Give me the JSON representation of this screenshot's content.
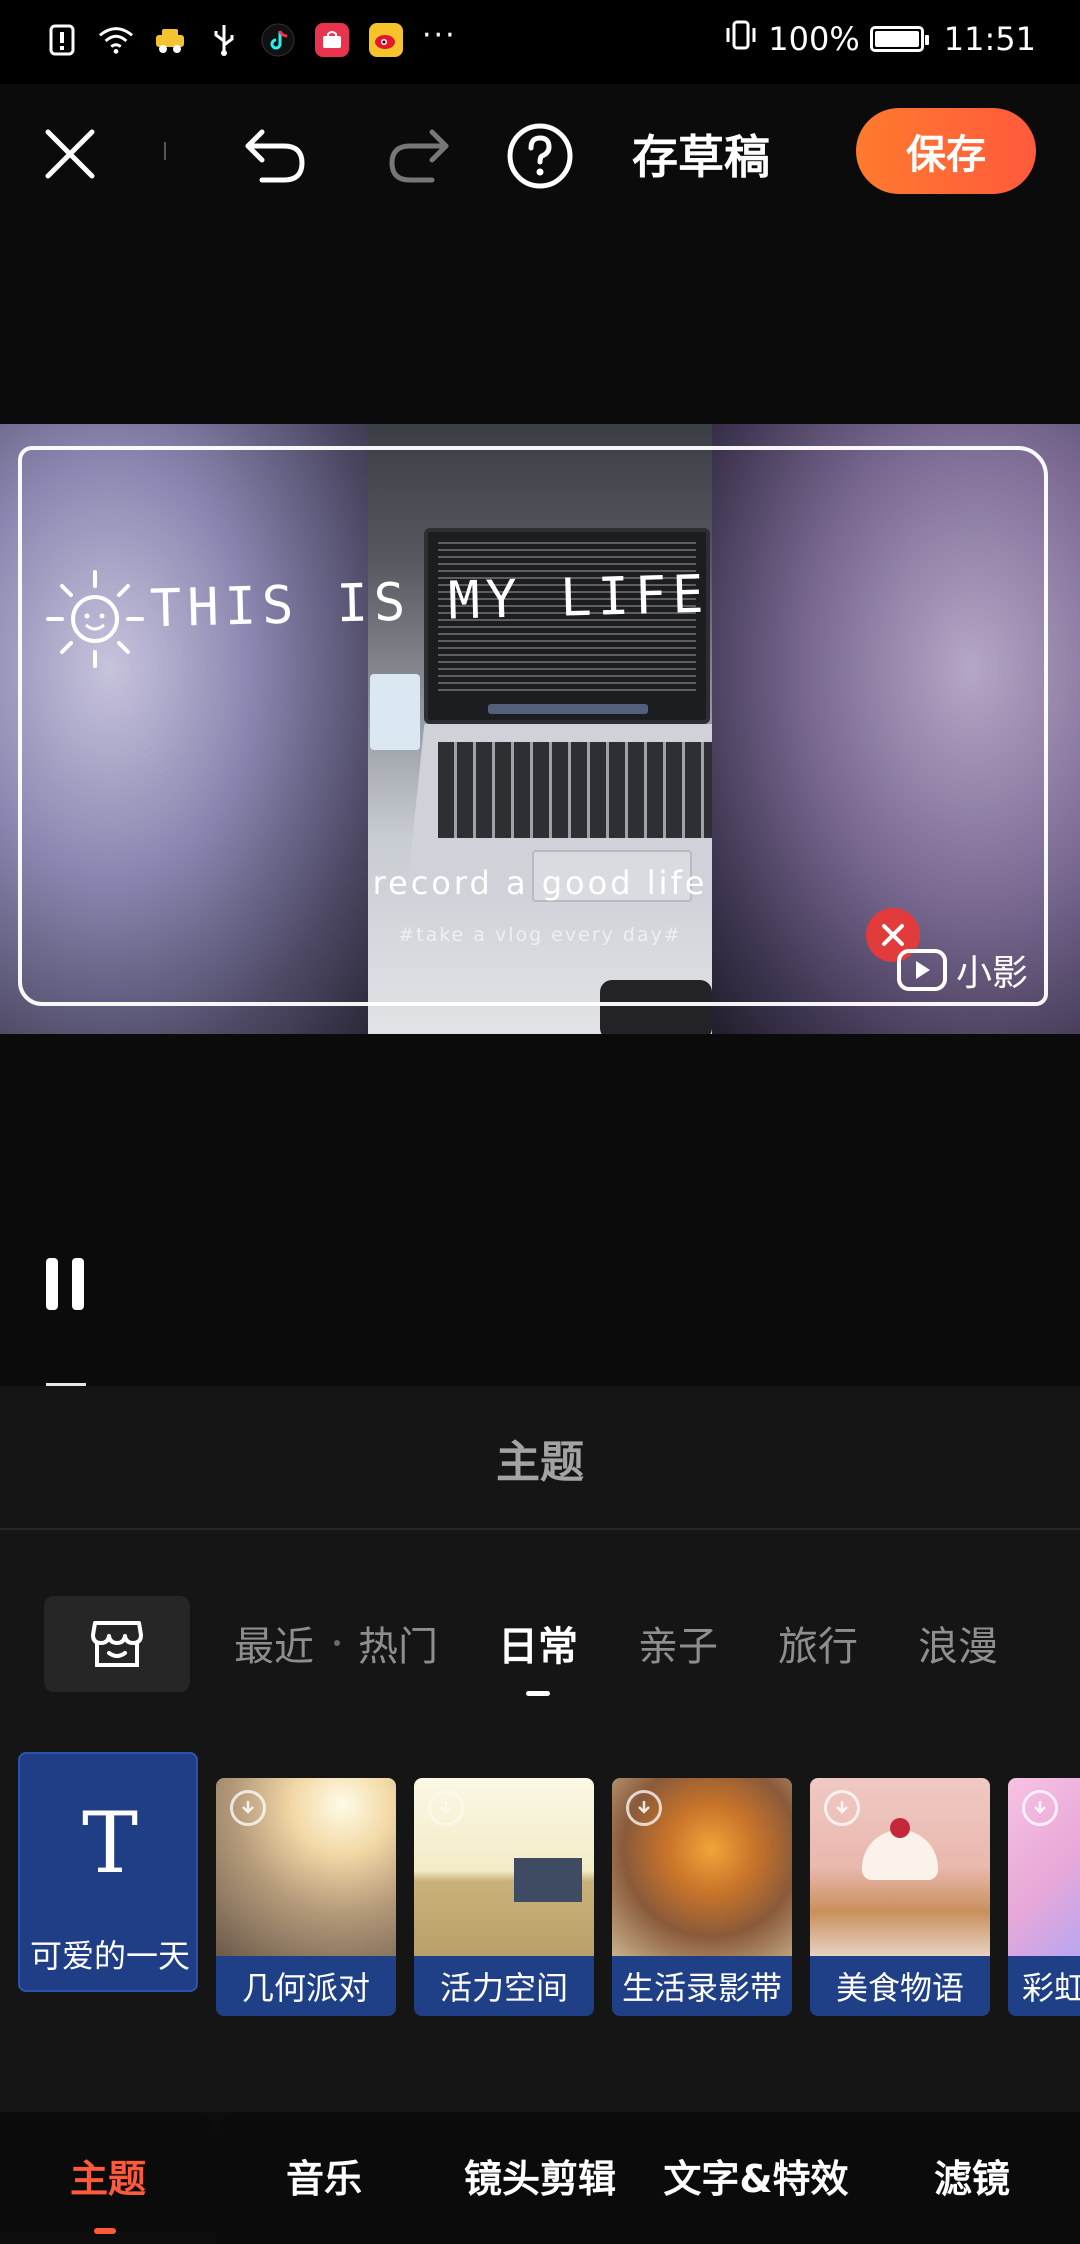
{
  "status_bar": {
    "battery_text": "100%",
    "time": "11:51",
    "overflow": "···",
    "battery_level": 1.0
  },
  "toolbar": {
    "draft_label": "存草稿",
    "save_label": "保存"
  },
  "preview": {
    "title_text": "THIS IS MY LIFE",
    "subtitle": "record a good life",
    "tagline": "#take a vlog every day#",
    "watermark": "小影"
  },
  "panel": {
    "title": "主题",
    "categories": [
      {
        "label": "最近"
      },
      {
        "label": "热门"
      },
      {
        "label": "日常"
      },
      {
        "label": "亲子"
      },
      {
        "label": "旅行"
      },
      {
        "label": "浪漫"
      }
    ],
    "active_category": "日常",
    "themes": [
      {
        "label": "可爱的一天",
        "icon": "T"
      },
      {
        "label": "几何派对"
      },
      {
        "label": "活力空间"
      },
      {
        "label": "生活录影带"
      },
      {
        "label": "美食物语"
      },
      {
        "label": "彩虹"
      }
    ]
  },
  "bottom_nav": {
    "items": [
      {
        "label": "主题"
      },
      {
        "label": "音乐"
      },
      {
        "label": "镜头剪辑"
      },
      {
        "label": "文字&特效"
      },
      {
        "label": "滤镜"
      }
    ],
    "active": "主题"
  },
  "colors": {
    "accent": "#ff5a3c",
    "theme_label_bg": "#1f3f86",
    "panel_bg": "#151515"
  }
}
